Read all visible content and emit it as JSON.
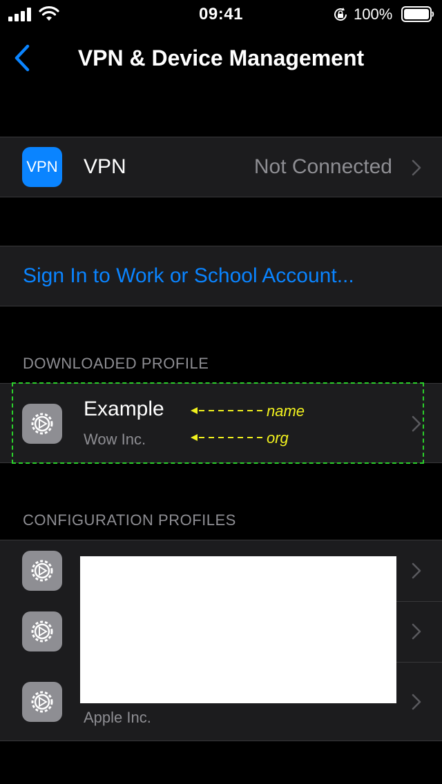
{
  "status_bar": {
    "time": "09:41",
    "battery_percent": "100%",
    "icons": [
      "cellular-signal-icon",
      "wifi-icon",
      "orientation-lock-icon",
      "battery-icon"
    ]
  },
  "nav": {
    "title": "VPN & Device Management",
    "back_icon": "chevron-left-icon"
  },
  "vpn": {
    "icon_label": "VPN",
    "label": "VPN",
    "value": "Not Connected"
  },
  "sign_in": {
    "label": "Sign In to Work or School Account..."
  },
  "downloaded_profile": {
    "header": "DOWNLOADED PROFILE",
    "name": "Example",
    "org": "Wow Inc.",
    "annotations": {
      "name": "name",
      "org": "org"
    }
  },
  "configuration_profiles": {
    "header": "CONFIGURATION PROFILES",
    "items": [
      {
        "org": ""
      },
      {
        "org": ""
      },
      {
        "org": "Apple Inc."
      }
    ]
  },
  "colors": {
    "accent": "#0a84ff",
    "cell_background": "#1c1c1e",
    "secondary_text": "#8e8e93",
    "annotation_yellow": "#f2f21e",
    "annotation_green": "#2bd12b"
  }
}
